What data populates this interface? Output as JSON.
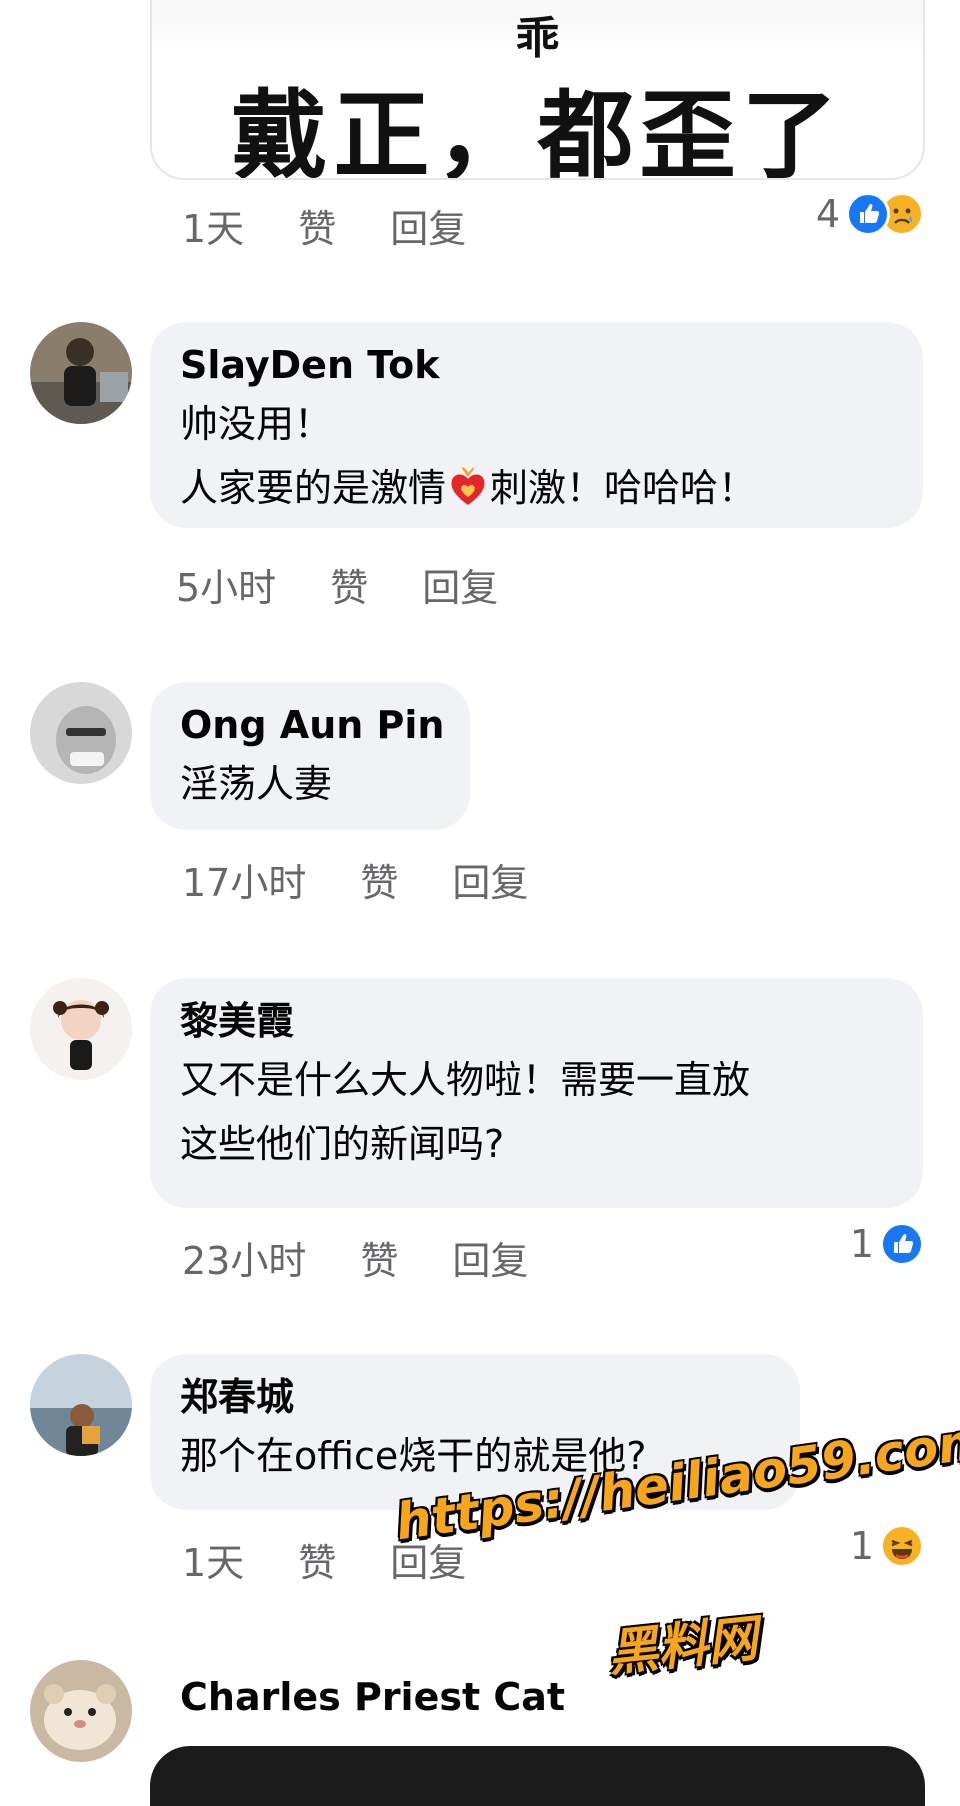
{
  "image_card": {
    "line1": "乖",
    "line2": "戴正，都歪了"
  },
  "comments": [
    {
      "time": "1天",
      "like": "赞",
      "reply": "回复",
      "reaction_count": "4"
    },
    {
      "name": "SlayDen Tok",
      "lines": [
        "帅没用！",
        "人家要的是激情",
        "刺激！哈哈哈！"
      ],
      "time": "5小时",
      "like": "赞",
      "reply": "回复"
    },
    {
      "name": "Ong Aun Pin",
      "lines": [
        "淫荡人妻"
      ],
      "time": "17小时",
      "like": "赞",
      "reply": "回复"
    },
    {
      "name": "黎美霞",
      "lines": [
        "又不是什么大人物啦！需要一直放",
        "这些他们的新闻吗?"
      ],
      "time": "23小时",
      "like": "赞",
      "reply": "回复",
      "reaction_count": "1"
    },
    {
      "name": "郑春城",
      "lines": [
        "那个在office烧干的就是他?"
      ],
      "time": "1天",
      "like": "赞",
      "reply": "回复",
      "reaction_count": "1"
    },
    {
      "name": "Charles Priest Cat"
    }
  ],
  "watermark": {
    "url": "https://heiliao59.com",
    "label": "黑料网"
  },
  "icons": {
    "like": "like-icon",
    "sad": "sad-face-icon",
    "laugh": "laughing-face-icon",
    "heart_fire": "heart-on-fire-icon"
  },
  "colors": {
    "bubble": "#f0f2f5",
    "meta": "#65676b",
    "like_blue": "#1877f2",
    "watermark": "#f7a51a"
  }
}
